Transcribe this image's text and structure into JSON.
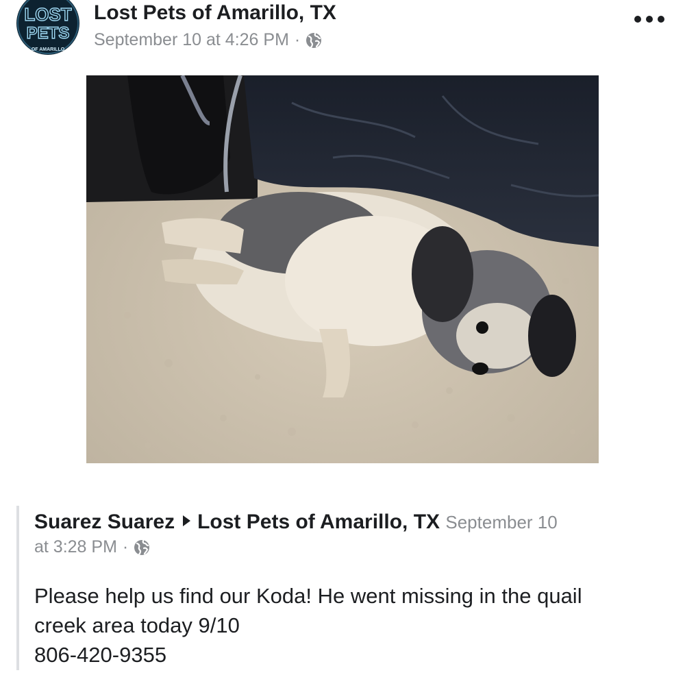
{
  "header": {
    "page_name": "Lost Pets of Amarillo, TX",
    "timestamp": "September 10 at 4:26 PM",
    "separator": "·",
    "privacy_icon": "globe-icon",
    "more_icon": "more-options-icon"
  },
  "avatar": {
    "logo_text_top": "LOST",
    "logo_text_mid": "PETS",
    "logo_text_bottom": "OF AMARILLO"
  },
  "shared_post": {
    "author": "Suarez Suarez",
    "target_page": "Lost Pets of Amarillo, TX",
    "date_part1": "September 10",
    "date_part2": "at 3:28 PM",
    "separator": "·",
    "privacy_icon": "globe-icon",
    "text_line1": "Please help us find our Koda! He went missing in the quail",
    "text_line2": "creek area today 9/10",
    "text_line3": "806-420-9355"
  },
  "colors": {
    "text_primary": "#1c1e21",
    "text_secondary": "#8a8d91",
    "divider": "#dddfe2"
  }
}
